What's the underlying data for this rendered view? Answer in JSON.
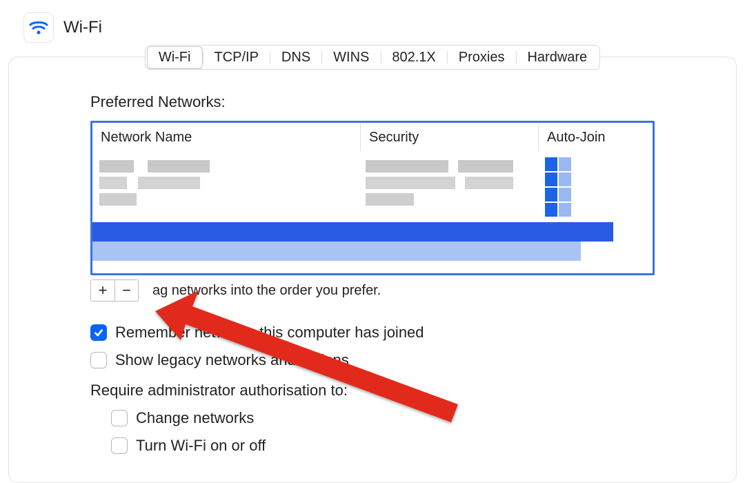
{
  "header": {
    "title": "Wi-Fi",
    "wifi_icon_color": "#0a63ff"
  },
  "tabs": {
    "items": [
      "Wi-Fi",
      "TCP/IP",
      "DNS",
      "WINS",
      "802.1X",
      "Proxies",
      "Hardware"
    ],
    "active_index": 0
  },
  "preferred_networks": {
    "label": "Preferred Networks:",
    "columns": {
      "name": "Network Name",
      "security": "Security",
      "autojoin": "Auto-Join"
    }
  },
  "add_remove": {
    "add_label": "+",
    "remove_label": "−",
    "drag_hint": "ag networks into the order you prefer.",
    "drag_hint_full": "Drag networks into the order you prefer."
  },
  "checkboxes": {
    "remember": {
      "label": "Remember networks this computer has joined",
      "checked": true
    },
    "legacy": {
      "label": "Show legacy networks and options",
      "checked": false
    },
    "auth_label": "Require administrator authorisation to:",
    "change_networks": {
      "label": "Change networks",
      "checked": false
    },
    "turn_wifi": {
      "label": "Turn Wi-Fi on or off",
      "checked": false
    }
  },
  "annotation": {
    "arrow_color": "#e22b1f"
  }
}
